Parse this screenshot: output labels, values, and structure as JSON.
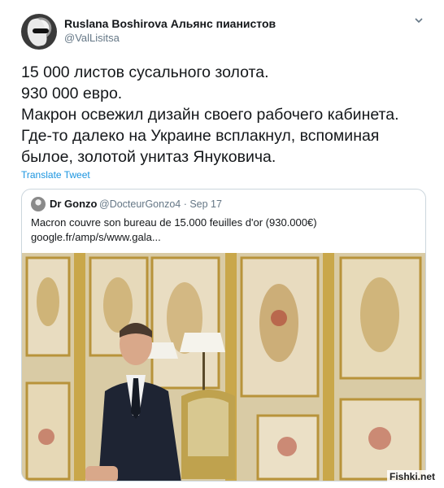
{
  "tweet": {
    "author_name": "Ruslana Boshirova Альянс пианистов",
    "author_handle": "@ValLisitsa",
    "lines": [
      "15 000 листов сусального золота.",
      "930 000 евро.",
      "Макрон освежил дизайн своего рабочего кабинета.",
      "Где-то далеко на Украине всплакнул, вспоминая",
      "былое, золотой унитаз Януковича."
    ],
    "translate_label": "Translate Tweet"
  },
  "quoted_tweet": {
    "author_name": "Dr Gonzo",
    "meta": "@DocteurGonzo4 · Sep 17",
    "text_lines": [
      "Macron couvre son bureau de 15.000 feuilles d'or (930.000€)",
      "google.fr/amp/s/www.gala..."
    ]
  },
  "icons": {
    "avatar": "avatar-icon",
    "caret": "chevron-down-icon",
    "photo": "photo-icon"
  },
  "watermark": "Fishki.net",
  "colors": {
    "link": "#1b95e0",
    "secondary_text": "#657786",
    "border": "#ccd6dd",
    "gold": "#c9a74a"
  }
}
